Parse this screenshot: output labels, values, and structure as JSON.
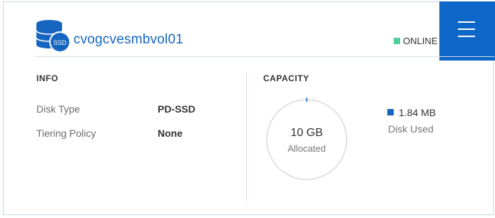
{
  "header": {
    "volume_name": "cvogcvesmbvol01",
    "icon_badge": "SSD",
    "status": "ONLINE",
    "status_color": "#4fcf9e",
    "accent_color": "#1565c0",
    "menu_icon": "hamburger-menu-icon"
  },
  "info": {
    "title": "INFO",
    "rows": [
      {
        "label": "Disk Type",
        "value": "PD-SSD"
      },
      {
        "label": "Tiering Policy",
        "value": "None"
      }
    ]
  },
  "capacity": {
    "title": "CAPACITY",
    "allocated_value": "10 GB",
    "allocated_label": "Allocated",
    "used_value": "1.84 MB",
    "used_label": "Disk Used",
    "used_color": "#1565c0"
  }
}
